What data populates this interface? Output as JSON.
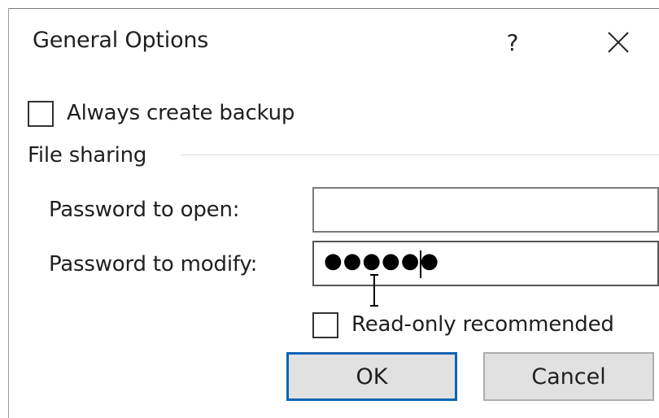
{
  "dialog": {
    "title": "General Options",
    "help_label": "?",
    "close_icon": "close-icon"
  },
  "backup": {
    "label": "Always create backup",
    "checked": false
  },
  "file_sharing": {
    "group_label": "File sharing",
    "password_open_label": "Password to open:",
    "password_open_value": "",
    "password_modify_label": "Password to modify:",
    "password_modify_value": "●●●●●●",
    "read_only_label": "Read-only recommended",
    "read_only_checked": false
  },
  "buttons": {
    "ok_label": "OK",
    "cancel_label": "Cancel"
  },
  "colors": {
    "focus_border": "#0a64b4",
    "button_face": "#e1e1e1"
  }
}
